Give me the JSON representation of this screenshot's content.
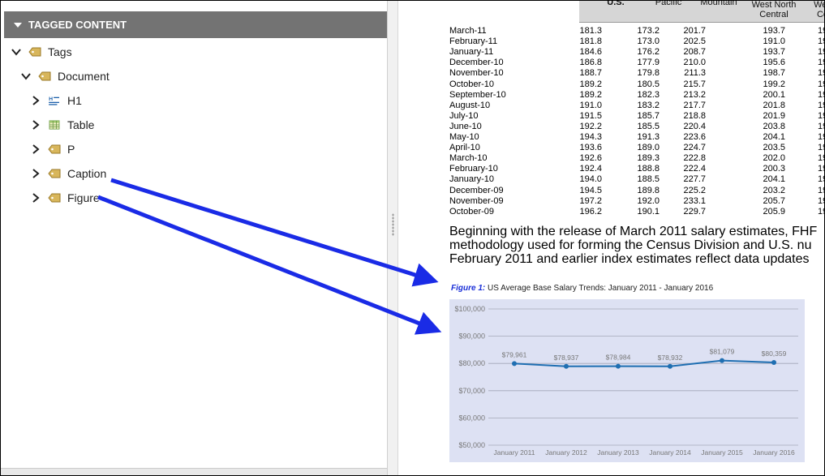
{
  "panel": {
    "title": "TAGGED CONTENT",
    "tree": [
      {
        "label": "Tags",
        "icon": "tag-icon",
        "level": 0,
        "expanded": true
      },
      {
        "label": "Document",
        "icon": "tag-icon",
        "level": 1,
        "expanded": true
      },
      {
        "label": "H1",
        "icon": "heading-icon",
        "level": 2,
        "expanded": false
      },
      {
        "label": "Table",
        "icon": "table-icon",
        "level": 2,
        "expanded": false
      },
      {
        "label": "P",
        "icon": "tag-icon",
        "level": 2,
        "expanded": false
      },
      {
        "label": "Caption",
        "icon": "tag-icon",
        "level": 2,
        "expanded": false
      },
      {
        "label": "Figure",
        "icon": "tag-icon",
        "level": 2,
        "expanded": false
      }
    ]
  },
  "table": {
    "headers": [
      "U.S.",
      "Pacific",
      "Mountain",
      "West North Central",
      "West Ce"
    ],
    "rows": [
      [
        "March-11",
        "181.3",
        "173.2",
        "201.7",
        "193.7",
        "19"
      ],
      [
        "February-11",
        "181.8",
        "173.0",
        "202.5",
        "191.0",
        "19"
      ],
      [
        "January-11",
        "184.6",
        "176.2",
        "208.7",
        "193.7",
        "19"
      ],
      [
        "December-10",
        "186.8",
        "177.9",
        "210.0",
        "195.6",
        "19"
      ],
      [
        "November-10",
        "188.7",
        "179.8",
        "211.3",
        "198.7",
        "19"
      ],
      [
        "October-10",
        "189.2",
        "180.5",
        "215.7",
        "199.2",
        "19"
      ],
      [
        "September-10",
        "189.2",
        "182.3",
        "213.2",
        "200.1",
        "19"
      ],
      [
        "August-10",
        "191.0",
        "183.2",
        "217.7",
        "201.8",
        "19"
      ],
      [
        "July-10",
        "191.5",
        "185.7",
        "218.8",
        "201.9",
        "19"
      ],
      [
        "June-10",
        "192.2",
        "185.5",
        "220.4",
        "203.8",
        "19"
      ],
      [
        "May-10",
        "194.3",
        "191.3",
        "223.6",
        "204.1",
        "19"
      ],
      [
        "April-10",
        "193.6",
        "189.0",
        "224.7",
        "203.5",
        "19"
      ],
      [
        "March-10",
        "192.6",
        "189.3",
        "222.8",
        "202.0",
        "19"
      ],
      [
        "February-10",
        "192.4",
        "188.8",
        "222.4",
        "200.3",
        "19"
      ],
      [
        "January-10",
        "194.0",
        "188.5",
        "227.7",
        "204.1",
        "19"
      ],
      [
        "December-09",
        "194.5",
        "189.8",
        "225.2",
        "203.2",
        "19"
      ],
      [
        "November-09",
        "197.2",
        "192.0",
        "233.1",
        "205.7",
        "19"
      ],
      [
        "October-09",
        "196.2",
        "190.1",
        "229.7",
        "205.9",
        "19"
      ]
    ]
  },
  "paragraph": {
    "lines": [
      "Beginning with the release of March 2011 salary estimates, FHF",
      "methodology used for forming the Census Division and U.S. nu",
      "February 2011 and earlier index estimates reflect data updates"
    ]
  },
  "caption": {
    "figure_label": "Figure 1:",
    "text": "US Average Base Salary Trends: January 2011 - January 2016"
  },
  "chart_data": {
    "type": "line",
    "categories": [
      "January 2011",
      "January 2012",
      "January 2013",
      "January 2014",
      "January 2015",
      "January 2016"
    ],
    "values": [
      79961,
      78937,
      78984,
      78932,
      81079,
      80359
    ],
    "data_labels": [
      "$79,961",
      "$78,937",
      "$78,984",
      "$78,932",
      "$81,079",
      "$80,359"
    ],
    "y_ticks": [
      "$100,000",
      "$90,000",
      "$80,000",
      "$70,000",
      "$60,000",
      "$50,000"
    ],
    "ylim": [
      50000,
      100000
    ],
    "grid": true,
    "title": "",
    "xlabel": "",
    "ylabel": "",
    "line_color": "#1f6fb2",
    "background": "#dde1f3"
  },
  "colors": {
    "arrow": "#1a2be6",
    "header_bg": "#737373"
  }
}
